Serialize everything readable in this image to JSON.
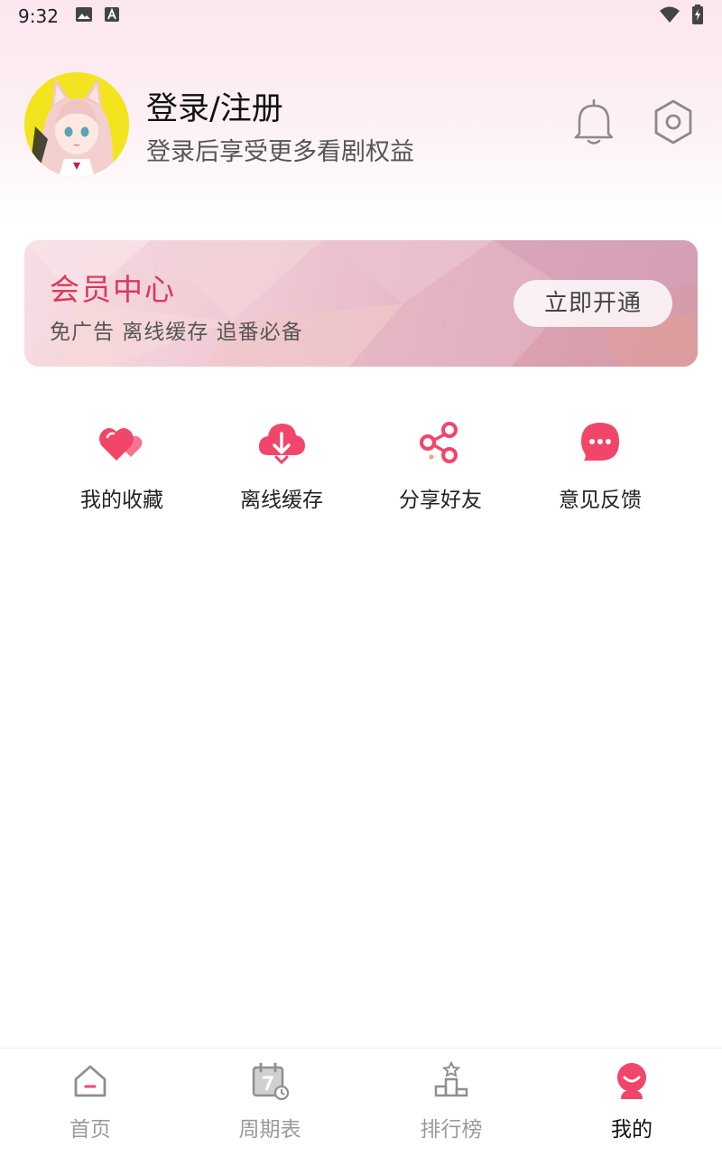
{
  "status_bar": {
    "time": "9:32",
    "left_icons": [
      "image-icon",
      "font-a-icon"
    ],
    "right_icons": [
      "wifi-icon",
      "battery-charging-icon"
    ]
  },
  "profile": {
    "title": "登录/注册",
    "subtitle": "登录后享受更多看剧权益",
    "avatar": "anime-girl-avatar",
    "actions": [
      "bell-icon",
      "settings-icon"
    ]
  },
  "vip": {
    "title": "会员中心",
    "subtitle": "免广告 离线缓存 追番必备",
    "button": "立即开通"
  },
  "quick_actions": [
    {
      "label": "我的收藏",
      "icon": "heart-icon"
    },
    {
      "label": "离线缓存",
      "icon": "cloud-download-icon"
    },
    {
      "label": "分享好友",
      "icon": "share-icon"
    },
    {
      "label": "意见反馈",
      "icon": "chat-bubble-icon"
    }
  ],
  "bottom_nav": [
    {
      "label": "首页",
      "icon": "home-icon",
      "active": false
    },
    {
      "label": "周期表",
      "icon": "calendar-icon",
      "active": false
    },
    {
      "label": "排行榜",
      "icon": "ranking-icon",
      "active": false
    },
    {
      "label": "我的",
      "icon": "profile-icon",
      "active": true
    }
  ],
  "colors": {
    "accent": "#f2456a",
    "vip_title": "#d93a5a",
    "inactive": "#9a9a9a"
  }
}
